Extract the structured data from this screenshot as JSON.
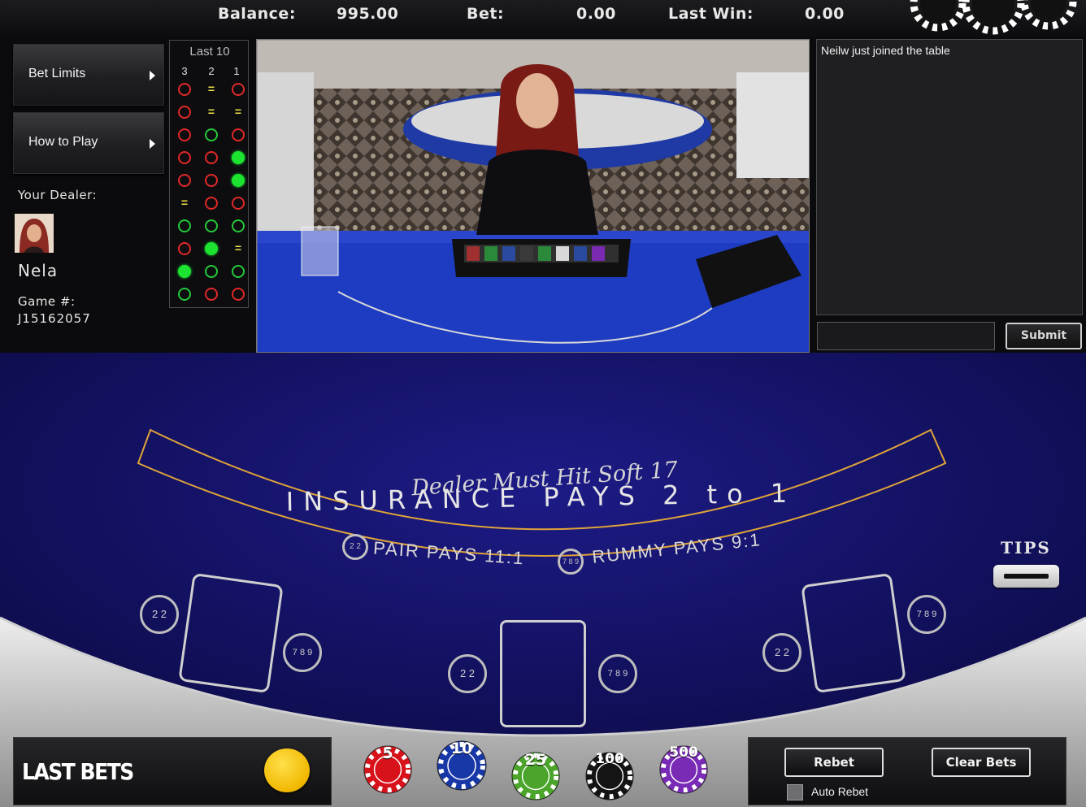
{
  "topbar": {
    "balance_label": "Balance:",
    "balance_value": "995.00",
    "bet_label": "Bet:",
    "bet_value": "0.00",
    "last_win_label": "Last Win:",
    "last_win_value": "0.00"
  },
  "menu": {
    "bet_limits": "Bet Limits",
    "how_to_play": "How to Play"
  },
  "dealer": {
    "label": "Your Dealer:",
    "name": "Nela",
    "game_label": "Game #:",
    "game_number": "J15162057"
  },
  "last10": {
    "title": "Last 10",
    "columns": [
      "3",
      "2",
      "1"
    ],
    "rows": [
      [
        "lost",
        "push",
        "lost"
      ],
      [
        "lost",
        "push",
        "push"
      ],
      [
        "lost",
        "won",
        "lost"
      ],
      [
        "lost",
        "lost",
        "blackjack"
      ],
      [
        "lost",
        "lost",
        "blackjack"
      ],
      [
        "push",
        "lost",
        "lost"
      ],
      [
        "won",
        "won",
        "won"
      ],
      [
        "lost",
        "blackjack",
        "push"
      ],
      [
        "blackjack",
        "won",
        "won"
      ],
      [
        "won",
        "lost",
        "lost"
      ]
    ]
  },
  "chat": {
    "messages": [
      "Neilw just joined the table"
    ],
    "input_value": "",
    "submit_label": "Submit"
  },
  "table_felt": {
    "rule_text": "Dealer Must Hit Soft 17",
    "insurance_text": "INSURANCE PAYS 2 to 1",
    "pair_text": "PAIR PAYS 11:1",
    "rummy_text": "RUMMY PAYS 9:1",
    "tips_label": "TIPS",
    "pair_icon": "2 2",
    "rummy_icon": "7 8 9"
  },
  "bottom": {
    "last_bets_label": "LAST BETS",
    "chips": [
      {
        "value": "5",
        "color": "#d8121a"
      },
      {
        "value": "10",
        "color": "#1838a8"
      },
      {
        "value": "25",
        "color": "#4aa52a"
      },
      {
        "value": "100",
        "color": "#141414"
      },
      {
        "value": "500",
        "color": "#7a2bb6"
      }
    ],
    "rebet_label": "Rebet",
    "clear_bets_label": "Clear Bets",
    "auto_rebet_label": "Auto Rebet"
  },
  "colors": {
    "felt": "#1a1a7a",
    "felt_border": "#e0a43a",
    "accent_yellow": "#f1b800"
  }
}
